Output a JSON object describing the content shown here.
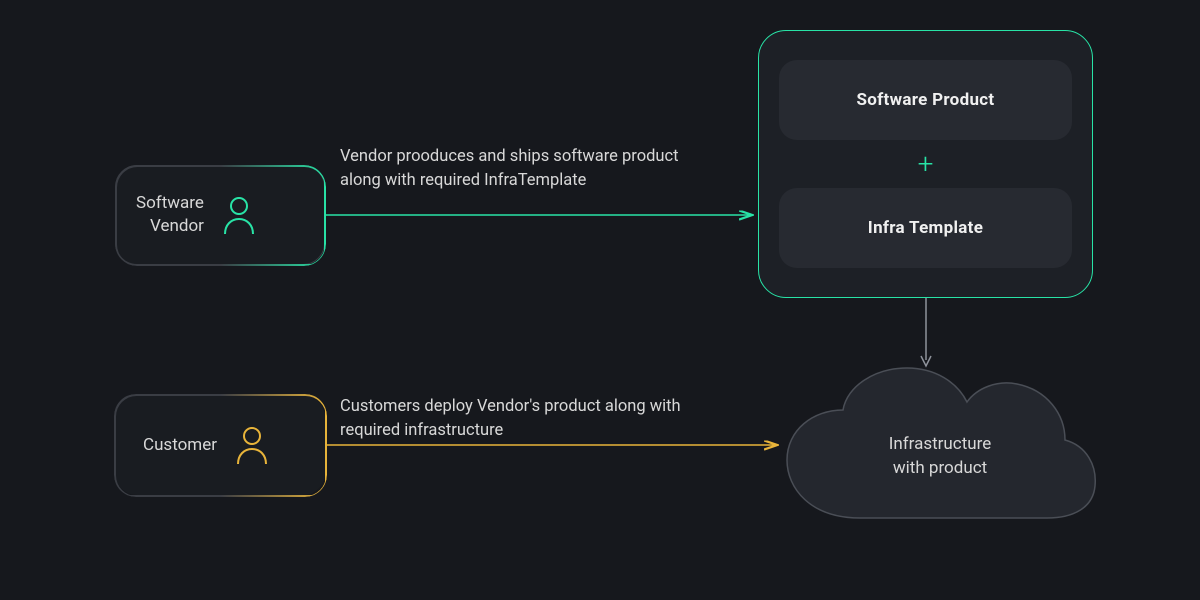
{
  "nodes": {
    "vendor": {
      "label": "Software\nVendor"
    },
    "customer": {
      "label": "Customer"
    },
    "package": {
      "top_card": "Software Product",
      "bottom_card": "Infra Template"
    },
    "cloud": {
      "label": "Infrastructure\nwith product"
    }
  },
  "arrows": {
    "vendor_to_package": {
      "description": "Vendor prooduces and ships software product along with required InfraTemplate"
    },
    "customer_to_cloud": {
      "description": "Customers deploy Vendor's product along with required infrastructure"
    }
  },
  "colors": {
    "accent_green": "#28e3a6",
    "accent_yellow": "#e8b43a",
    "bg": "#16181d",
    "card": "#272a31",
    "border_muted": "#3a3d44",
    "text": "#d8d8d8"
  }
}
